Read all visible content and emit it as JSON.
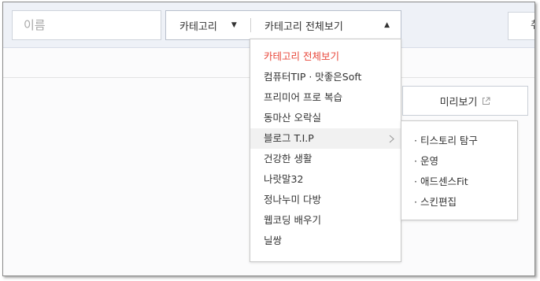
{
  "filters": {
    "name_placeholder": "이름",
    "category_label": "카테고리",
    "category_selected": "카테고리 전체보기",
    "right_button_label": "취"
  },
  "preview": {
    "label": "미리보기",
    "icon": "external-link-icon"
  },
  "dropdown": {
    "items": [
      {
        "label": "카테고리 전체보기"
      },
      {
        "label": "컴퓨터TIP · 맛좋은Soft"
      },
      {
        "label": "프리미어 프로 복습"
      },
      {
        "label": "동마산 오락실"
      },
      {
        "label": "블로그 T.I.P"
      },
      {
        "label": "건강한 생활"
      },
      {
        "label": "나랏말32"
      },
      {
        "label": "정나누미 다방"
      },
      {
        "label": "웹코딩 배우기"
      },
      {
        "label": "닐쌍"
      }
    ],
    "active_index": 0,
    "hover_index": 4,
    "submenu_arrow_icon": "chevron-right-icon"
  },
  "submenu": {
    "items": [
      {
        "label": "· 티스토리 탐구"
      },
      {
        "label": "· 운영"
      },
      {
        "label": "· 애드센스Fit"
      },
      {
        "label": "· 스킨편집"
      }
    ]
  },
  "colors": {
    "active_item": "#e8473a",
    "topbar_bg": "#eef1f7"
  }
}
